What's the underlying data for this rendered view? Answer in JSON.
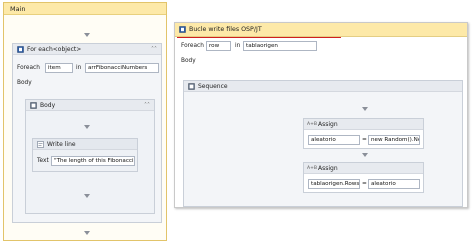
{
  "main": {
    "title": "Main",
    "foreach": {
      "title": "For each<object>",
      "foreach_label": "Foreach",
      "item_value": "item",
      "in_label": "in",
      "collection_value": "arrFibonacciNumbers",
      "body_label": "Body",
      "body_block": {
        "title": "Body",
        "writeline": {
          "title": "Write line",
          "text_label": "Text",
          "text_value": "\"The length of this Fibonacci"
        }
      }
    }
  },
  "second": {
    "title": "Bucle write files OSP/JT",
    "foreach_label": "Foreach",
    "item_value": "row",
    "in_label": "in",
    "collection_value": "tablaorigen",
    "body_label": "Body",
    "sequence": {
      "title": "Sequence",
      "assign1": {
        "title": "Assign",
        "left_value": "aleatorio",
        "op": "=",
        "right_value": "new Random().Ne:"
      },
      "assign2": {
        "title": "Assign",
        "left_value": "tablaorigen.Rows(i",
        "op": "=",
        "right_value": "aleatorio"
      }
    }
  },
  "colors": {
    "header_yellow": "#fde9a8",
    "accent_red": "#d02020",
    "panel_border": "#c9cfd8"
  },
  "icons": {
    "foreach": "foreach-icon",
    "body": "body-icon",
    "writeline": "write-line-icon",
    "sequence": "sequence-icon",
    "assign": "assign-icon",
    "collapse": "collapse-chevron-icon"
  }
}
